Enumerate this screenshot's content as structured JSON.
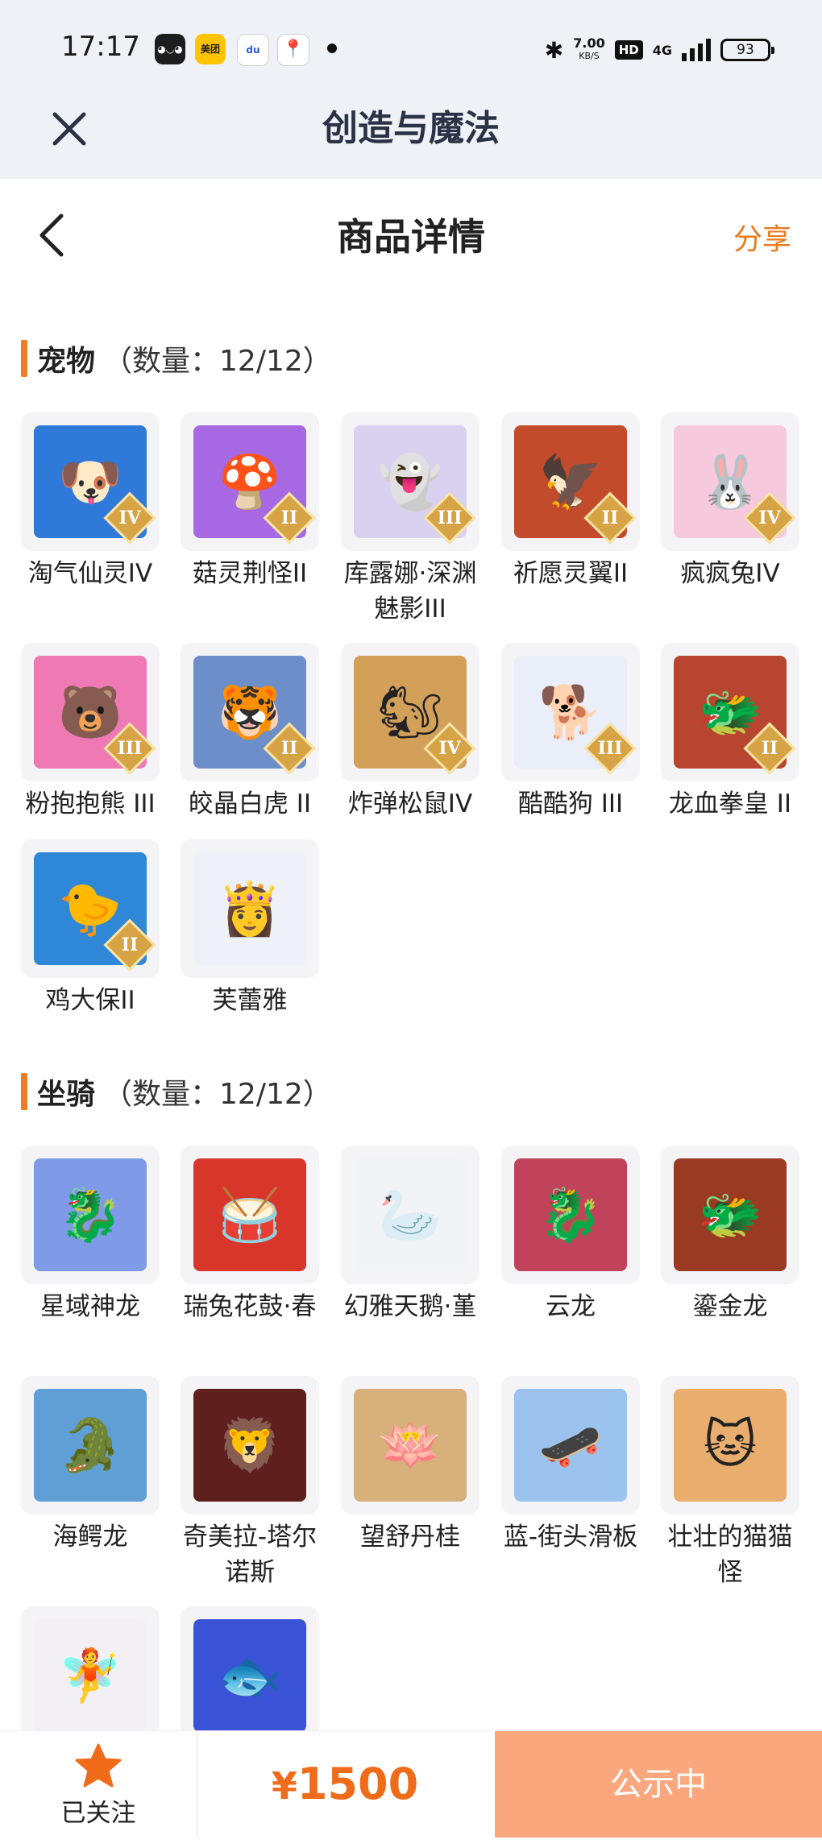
{
  "status_bar": {
    "time": "17:17",
    "notifications": [
      "ghost-app-icon",
      "美团",
      "baidu-map-icon",
      "map-pin-icon"
    ],
    "speed_value": "7.00",
    "speed_unit": "KB/S",
    "hd": "HD",
    "network": "4G",
    "battery": "93"
  },
  "app_bar": {
    "title": "创造与魔法",
    "close_icon": "close-icon"
  },
  "header": {
    "title": "商品详情",
    "share": "分享",
    "back_icon": "chevron-left-icon"
  },
  "pets": {
    "title": "宠物",
    "count": "（数量：12/12）",
    "items": [
      {
        "name": "淘气仙灵IV",
        "rank": "IV",
        "color": "#2f7ad8",
        "glyph": "🐶"
      },
      {
        "name": "菇灵荆怪II",
        "rank": "II",
        "color": "#a768e4",
        "glyph": "🍄"
      },
      {
        "name": "库露娜·深渊魅影III",
        "rank": "III",
        "color": "#d8d2f0",
        "glyph": "👻"
      },
      {
        "name": "祈愿灵翼II",
        "rank": "II",
        "color": "#c24b2c",
        "glyph": "🦅"
      },
      {
        "name": "疯疯兔IV",
        "rank": "IV",
        "color": "#f7c9dc",
        "glyph": "🐰"
      },
      {
        "name": "粉抱抱熊 III",
        "rank": "III",
        "color": "#ee79b3",
        "glyph": "🐻"
      },
      {
        "name": "皎晶白虎 II",
        "rank": "II",
        "color": "#6c8ec9",
        "glyph": "🐯"
      },
      {
        "name": "炸弹松鼠IV",
        "rank": "IV",
        "color": "#d3a05a",
        "glyph": "🐿"
      },
      {
        "name": "酷酷狗 III",
        "rank": "III",
        "color": "#e9eef8",
        "glyph": "🐕"
      },
      {
        "name": "龙血拳皇 II",
        "rank": "II",
        "color": "#b8452f",
        "glyph": "🐲"
      },
      {
        "name": "鸡大保II",
        "rank": "II",
        "color": "#2f87d8",
        "glyph": "🐤"
      },
      {
        "name": "芙蕾雅",
        "rank": "",
        "color": "#eef1f7",
        "glyph": "👸"
      }
    ]
  },
  "mounts": {
    "title": "坐骑",
    "count": "（数量：12/12）",
    "items": [
      {
        "name": "星域神龙",
        "color": "#7f9be8",
        "glyph": "🐉"
      },
      {
        "name": "瑞兔花鼓·春",
        "color": "#d8362a",
        "glyph": "🥁"
      },
      {
        "name": "幻雅天鹅·堇",
        "color": "#f2f3f6",
        "glyph": "🦢"
      },
      {
        "name": "云龙",
        "color": "#c1435b",
        "glyph": "🐉"
      },
      {
        "name": "鎏金龙",
        "color": "#9a3a22",
        "glyph": "🐲"
      },
      {
        "name": "海鳄龙",
        "color": "#5f9fd6",
        "glyph": "🐊"
      },
      {
        "name": "奇美拉-塔尔诺斯",
        "color": "#5e1f1e",
        "glyph": "🦁"
      },
      {
        "name": "望舒丹桂",
        "color": "#d7b07b",
        "glyph": "🪷"
      },
      {
        "name": "蓝-街头滑板",
        "color": "#9bc3ee",
        "glyph": "🛹"
      },
      {
        "name": "壮壮的猫猫怪",
        "color": "#e9ad6e",
        "glyph": "🐱"
      },
      {
        "name": "",
        "color": "#f2f0f5",
        "glyph": "🧚"
      },
      {
        "name": "",
        "color": "#3a53d6",
        "glyph": "🐟"
      }
    ]
  },
  "bottom": {
    "follow_label": "已关注",
    "currency": "¥",
    "price": "1500",
    "status_button": "公示中",
    "accent": "#f06b1a",
    "button_color": "#fba77d"
  }
}
